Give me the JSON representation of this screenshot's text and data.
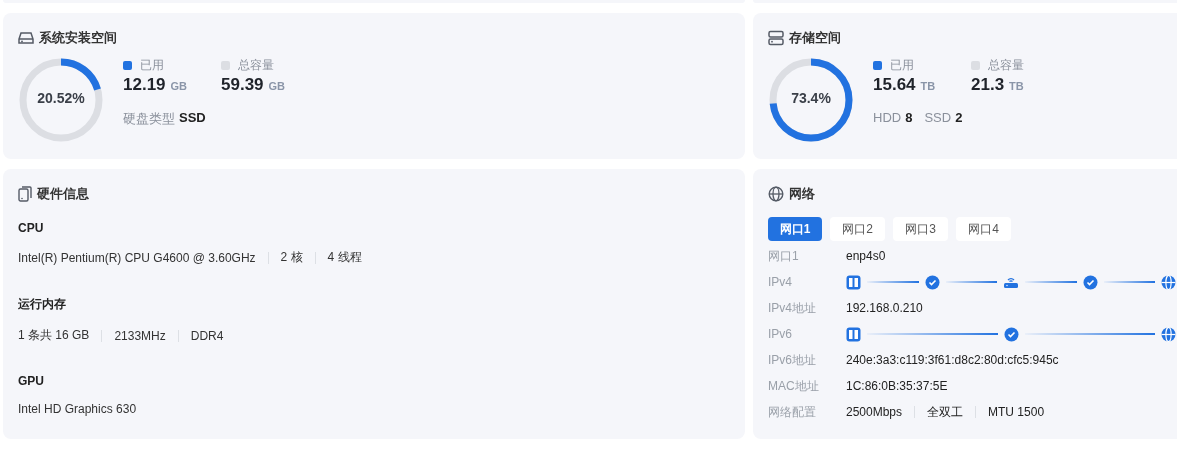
{
  "system_space": {
    "title": "系统安装空间",
    "percent": "20.52%",
    "legend": [
      {
        "label": "已用",
        "value": "12.19",
        "unit": "GB",
        "color": "#2272e0"
      },
      {
        "label": "总容量",
        "value": "59.39",
        "unit": "GB",
        "color": "#dcdee3"
      }
    ],
    "details": [
      {
        "label": "硬盘类型",
        "value": "SSD"
      }
    ]
  },
  "storage": {
    "title": "存储空间",
    "percent": "73.4%",
    "legend": [
      {
        "label": "已用",
        "value": "15.64",
        "unit": "TB",
        "color": "#2272e0"
      },
      {
        "label": "总容量",
        "value": "21.3",
        "unit": "TB",
        "color": "#dcdee3"
      }
    ],
    "details": [
      {
        "label": "HDD",
        "value": "8"
      },
      {
        "label": "SSD",
        "value": "2"
      }
    ]
  },
  "hardware": {
    "title": "硬件信息",
    "sections": [
      {
        "heading": "CPU",
        "values": [
          "Intel(R) Pentium(R) CPU G4600 @ 3.60GHz",
          "2 核",
          "4 线程"
        ]
      },
      {
        "heading": "运行内存",
        "values": [
          "1 条共 16 GB",
          "2133MHz",
          "DDR4"
        ]
      },
      {
        "heading": "GPU",
        "values": [
          "Intel HD Graphics 630"
        ]
      }
    ]
  },
  "network": {
    "title": "网络",
    "tabs": [
      {
        "label": "网口1",
        "selected": true
      },
      {
        "label": "网口2",
        "selected": false
      },
      {
        "label": "网口3",
        "selected": false
      },
      {
        "label": "网口4",
        "selected": false
      }
    ],
    "rows": [
      {
        "kind": "text",
        "label": "网口1",
        "values": [
          "enp4s0"
        ]
      },
      {
        "kind": "path",
        "label": "IPv4",
        "via_router": true
      },
      {
        "kind": "text",
        "label": "IPv4地址",
        "values": [
          "192.168.0.210"
        ]
      },
      {
        "kind": "path",
        "label": "IPv6",
        "via_router": false
      },
      {
        "kind": "text",
        "label": "IPv6地址",
        "values": [
          "240e:3a3:c119:3f61:d8c2:80d:cfc5:945c"
        ]
      },
      {
        "kind": "text",
        "label": "MAC地址",
        "values": [
          "1C:86:0B:35:37:5E"
        ]
      },
      {
        "kind": "text",
        "label": "网络配置",
        "values": [
          "2500Mbps",
          "全双工",
          "MTU 1500"
        ]
      }
    ]
  }
}
